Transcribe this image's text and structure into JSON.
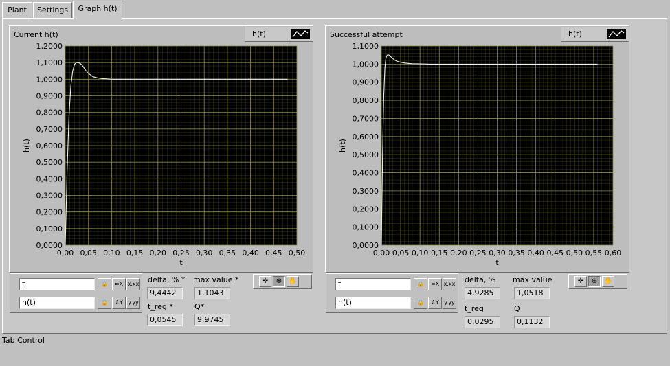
{
  "tabs": [
    {
      "label": "Plant"
    },
    {
      "label": "Settings"
    },
    {
      "label": "Graph h(t)"
    }
  ],
  "active_tab": "Graph h(t)",
  "footer_label": "Tab Control",
  "colors": {
    "plot_bg": "#000000",
    "grid": "#6b6b2e",
    "curve": "#f0f0f0"
  },
  "graph1": {
    "title": "Current h(t)",
    "legend_label": "h(t)",
    "scale_x_label": "t",
    "scale_y_label": "h(t)",
    "delta_label": "delta, % *",
    "delta_value": "9,4442",
    "max_label": "max value *",
    "max_value": "1,1043",
    "treg_label": "t_reg *",
    "treg_value": "0,0545",
    "q_label": "Q*",
    "q_value": "9,9745"
  },
  "graph2": {
    "title": "Successful attempt",
    "legend_label": "h(t)",
    "scale_x_label": "t",
    "scale_y_label": "h(t)",
    "delta_label": "delta, %",
    "delta_value": "4,9285",
    "max_label": "max value",
    "max_value": "1,0518",
    "treg_label": "t_reg",
    "treg_value": "0,0295",
    "q_label": "Q",
    "q_value": "0,1132"
  },
  "chart_data": [
    {
      "type": "line",
      "title": "Current h(t)",
      "xlabel": "t",
      "ylabel": "h(t)",
      "xlim": [
        0,
        0.5
      ],
      "ylim": [
        0,
        1.2
      ],
      "grid": true,
      "x_ticks": [
        "0,00",
        "0,05",
        "0,10",
        "0,15",
        "0,20",
        "0,25",
        "0,30",
        "0,35",
        "0,40",
        "0,45",
        "0,50"
      ],
      "y_ticks": [
        "0,0000",
        "0,1000",
        "0,2000",
        "0,3000",
        "0,4000",
        "0,5000",
        "0,6000",
        "0,7000",
        "0,8000",
        "0,9000",
        "1,0000",
        "1,1000",
        "1,2000"
      ],
      "series": [
        {
          "name": "h(t)",
          "x": [
            0,
            0.004,
            0.008,
            0.012,
            0.016,
            0.02,
            0.024,
            0.028,
            0.032,
            0.036,
            0.04,
            0.045,
            0.05,
            0.055,
            0.06,
            0.07,
            0.08,
            0.09,
            0.1,
            0.12,
            0.15,
            0.2,
            0.3,
            0.4,
            0.48
          ],
          "y": [
            0,
            0.45,
            0.78,
            0.96,
            1.05,
            1.09,
            1.1,
            1.1,
            1.095,
            1.085,
            1.07,
            1.05,
            1.035,
            1.025,
            1.015,
            1.008,
            1.004,
            1.002,
            1.0,
            1.0,
            1.0,
            1.0,
            1.0,
            1.0,
            1.0
          ]
        }
      ]
    },
    {
      "type": "line",
      "title": "Successful attempt",
      "xlabel": "t",
      "ylabel": "h(t)",
      "xlim": [
        0,
        0.6
      ],
      "ylim": [
        0,
        1.1
      ],
      "grid": true,
      "x_ticks": [
        "0,00",
        "0,05",
        "0,10",
        "0,15",
        "0,20",
        "0,25",
        "0,30",
        "0,35",
        "0,40",
        "0,45",
        "0,50",
        "0,55",
        "0,60"
      ],
      "y_ticks": [
        "0,0000",
        "0,1000",
        "0,2000",
        "0,3000",
        "0,4000",
        "0,5000",
        "0,6000",
        "0,7000",
        "0,8000",
        "0,9000",
        "1,0000",
        "1,1000"
      ],
      "series": [
        {
          "name": "h(t)",
          "x": [
            0,
            0.003,
            0.006,
            0.009,
            0.012,
            0.015,
            0.018,
            0.021,
            0.025,
            0.03,
            0.035,
            0.04,
            0.05,
            0.06,
            0.07,
            0.08,
            0.1,
            0.13,
            0.2,
            0.3,
            0.4,
            0.5,
            0.56
          ],
          "y": [
            0,
            0.5,
            0.82,
            0.98,
            1.035,
            1.05,
            1.052,
            1.048,
            1.04,
            1.03,
            1.022,
            1.016,
            1.01,
            1.006,
            1.004,
            1.002,
            1.001,
            1.0,
            1.0,
            1.0,
            1.0,
            1.0,
            1.0
          ]
        }
      ]
    }
  ]
}
